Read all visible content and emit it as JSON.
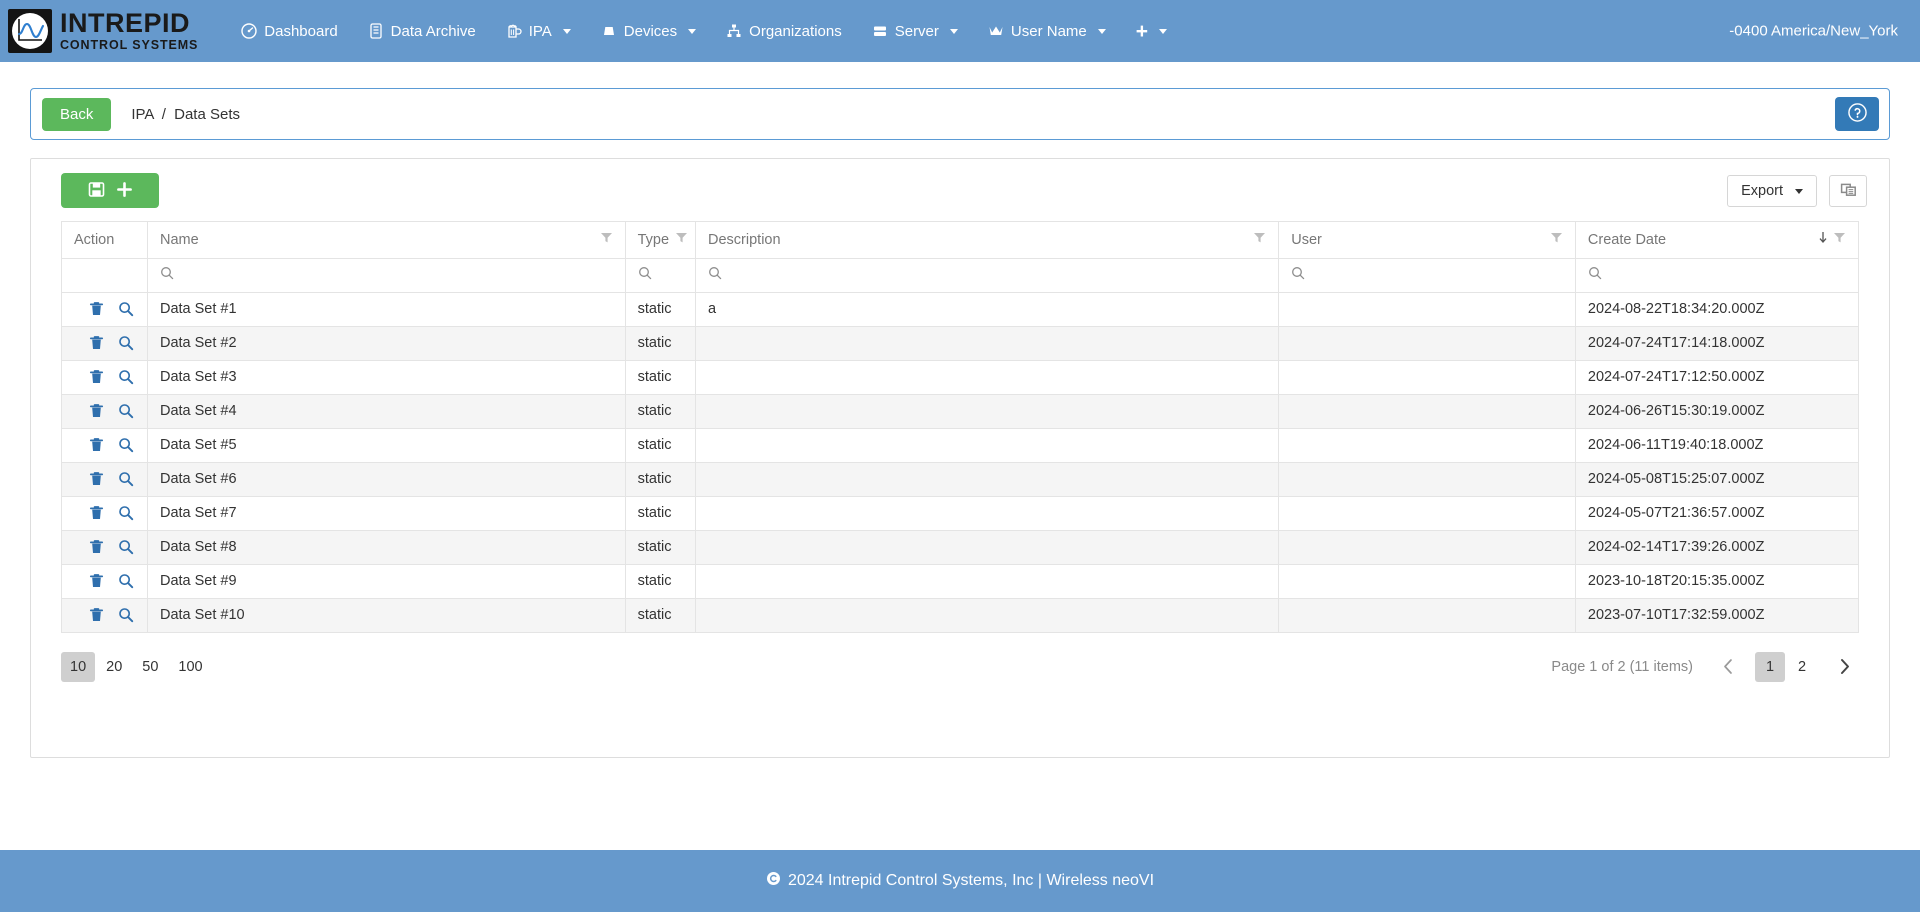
{
  "navbar": {
    "brand": {
      "top": "INTREPID",
      "bottom": "CONTROL SYSTEMS",
      "logo_icon": "waveform-logo-icon"
    },
    "items": [
      {
        "label": "Dashboard",
        "icon": "dashboard-icon",
        "caret": false
      },
      {
        "label": "Data Archive",
        "icon": "data-archive-icon",
        "caret": false
      },
      {
        "label": "IPA",
        "icon": "beer-mug-icon",
        "caret": true
      },
      {
        "label": "Devices",
        "icon": "device-icon",
        "caret": true
      },
      {
        "label": "Organizations",
        "icon": "sitemap-icon",
        "caret": false
      },
      {
        "label": "Server",
        "icon": "server-icon",
        "caret": true
      },
      {
        "label": "User Name",
        "icon": "crown-icon",
        "caret": true
      }
    ],
    "plus_item": {
      "label": "+",
      "icon": "plus-icon",
      "caret": true
    },
    "timezone": "-0400 America/New_York"
  },
  "breadcrumb": {
    "back_label": "Back",
    "root": "IPA",
    "separator": "/",
    "current": "Data Sets",
    "help_icon": "question-circle-icon"
  },
  "toolbar": {
    "add_button": {
      "save_icon": "save-icon",
      "plus_icon": "plus-icon"
    },
    "export_label": "Export",
    "export_caret_icon": "caret-down-icon",
    "copy_icon": "copy-columns-icon"
  },
  "table": {
    "columns": [
      {
        "label": "Action",
        "filter": false,
        "sort": null
      },
      {
        "label": "Name",
        "filter": true,
        "sort": null
      },
      {
        "label": "Type",
        "filter": true,
        "sort": null
      },
      {
        "label": "Description",
        "filter": true,
        "sort": null
      },
      {
        "label": "User",
        "filter": true,
        "sort": null
      },
      {
        "label": "Create Date",
        "filter": true,
        "sort": "desc"
      }
    ],
    "filter_row": {
      "search_icon": "search-icon",
      "searchable": [
        false,
        true,
        true,
        true,
        true,
        true
      ]
    },
    "row_icons": {
      "delete_icon": "trash-icon",
      "view_icon": "magnifier-icon"
    },
    "rows": [
      {
        "name": "Data Set #1",
        "type": "static",
        "description": "a",
        "user": "",
        "create_date": "2024-08-22T18:34:20.000Z"
      },
      {
        "name": "Data Set #2",
        "type": "static",
        "description": "",
        "user": "",
        "create_date": "2024-07-24T17:14:18.000Z"
      },
      {
        "name": "Data Set #3",
        "type": "static",
        "description": "",
        "user": "",
        "create_date": "2024-07-24T17:12:50.000Z"
      },
      {
        "name": "Data Set #4",
        "type": "static",
        "description": "",
        "user": "",
        "create_date": "2024-06-26T15:30:19.000Z"
      },
      {
        "name": "Data Set #5",
        "type": "static",
        "description": "",
        "user": "",
        "create_date": "2024-06-11T19:40:18.000Z"
      },
      {
        "name": "Data Set #6",
        "type": "static",
        "description": "",
        "user": "",
        "create_date": "2024-05-08T15:25:07.000Z"
      },
      {
        "name": "Data Set #7",
        "type": "static",
        "description": "",
        "user": "",
        "create_date": "2024-05-07T21:36:57.000Z"
      },
      {
        "name": "Data Set #8",
        "type": "static",
        "description": "",
        "user": "",
        "create_date": "2024-02-14T17:39:26.000Z"
      },
      {
        "name": "Data Set #9",
        "type": "static",
        "description": "",
        "user": "",
        "create_date": "2023-10-18T20:15:35.000Z"
      },
      {
        "name": "Data Set #10",
        "type": "static",
        "description": "",
        "user": "",
        "create_date": "2023-07-10T17:32:59.000Z"
      }
    ]
  },
  "pagination": {
    "page_sizes": [
      "10",
      "20",
      "50",
      "100"
    ],
    "active_page_size": "10",
    "info": "Page 1 of 2 (11 items)",
    "pages": [
      "1",
      "2"
    ],
    "active_page": "1",
    "prev_icon": "chevron-left-icon",
    "next_icon": "chevron-right-icon"
  },
  "footer": {
    "copyright_icon": "copyright-icon",
    "text": "2024  Intrepid Control Systems, Inc | Wireless neoVI"
  },
  "colors": {
    "nav_blue": "#6699cc",
    "green": "#5cb85c",
    "help_blue": "#337ab7",
    "icon_blue": "#2f6fad",
    "row_alt": "#f5f5f5",
    "muted": "#777777"
  }
}
